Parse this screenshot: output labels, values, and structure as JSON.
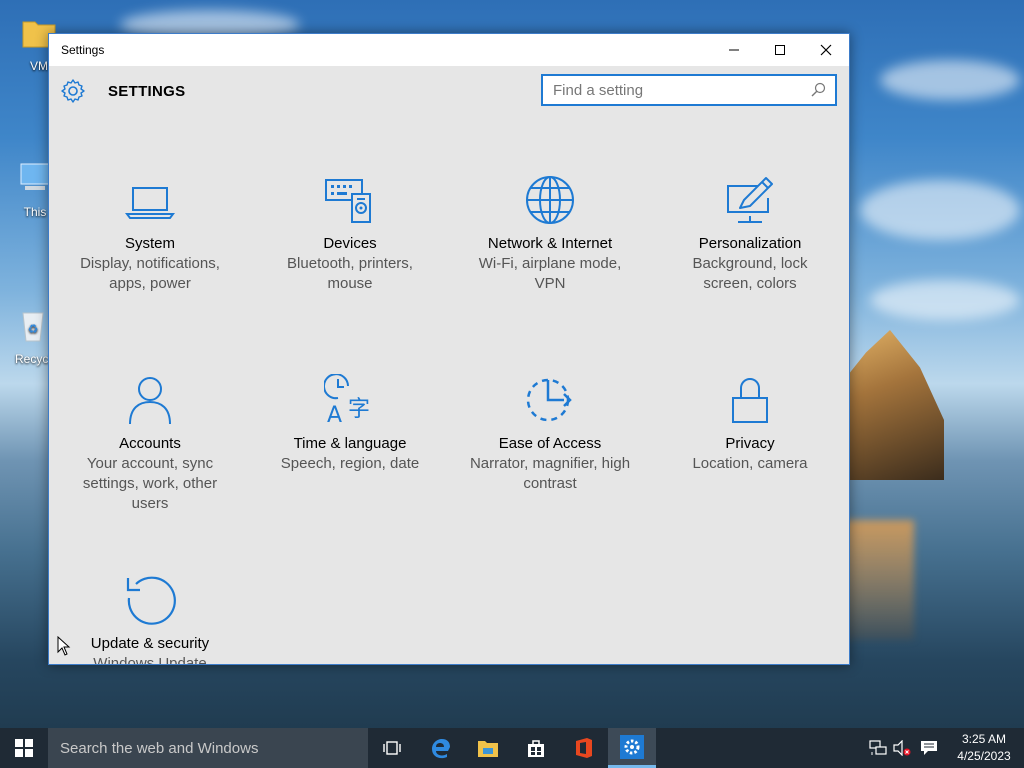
{
  "desktop": {
    "icons": [
      {
        "label": "VM"
      },
      {
        "label": "This"
      },
      {
        "label": "Recycl"
      }
    ]
  },
  "window": {
    "title": "Settings",
    "heading": "SETTINGS",
    "search_placeholder": "Find a setting",
    "accent": "#1e7ad3"
  },
  "categories": [
    {
      "name": "System",
      "desc": "Display, notifications, apps, power",
      "icon": "laptop-icon"
    },
    {
      "name": "Devices",
      "desc": "Bluetooth, printers, mouse",
      "icon": "devices-icon"
    },
    {
      "name": "Network & Internet",
      "desc": "Wi-Fi, airplane mode, VPN",
      "icon": "globe-icon"
    },
    {
      "name": "Personalization",
      "desc": "Background, lock screen, colors",
      "icon": "paintbrush-icon"
    },
    {
      "name": "Accounts",
      "desc": "Your account, sync settings, work, other users",
      "icon": "person-icon"
    },
    {
      "name": "Time & language",
      "desc": "Speech, region, date",
      "icon": "time-language-icon"
    },
    {
      "name": "Ease of Access",
      "desc": "Narrator, magnifier, high contrast",
      "icon": "ease-of-access-icon"
    },
    {
      "name": "Privacy",
      "desc": "Location, camera",
      "icon": "lock-icon"
    },
    {
      "name": "Update & security",
      "desc": "Windows Update",
      "icon": "refresh-icon"
    }
  ],
  "taskbar": {
    "search_placeholder": "Search the web and Windows",
    "time": "3:25 AM",
    "date": "4/25/2023"
  }
}
